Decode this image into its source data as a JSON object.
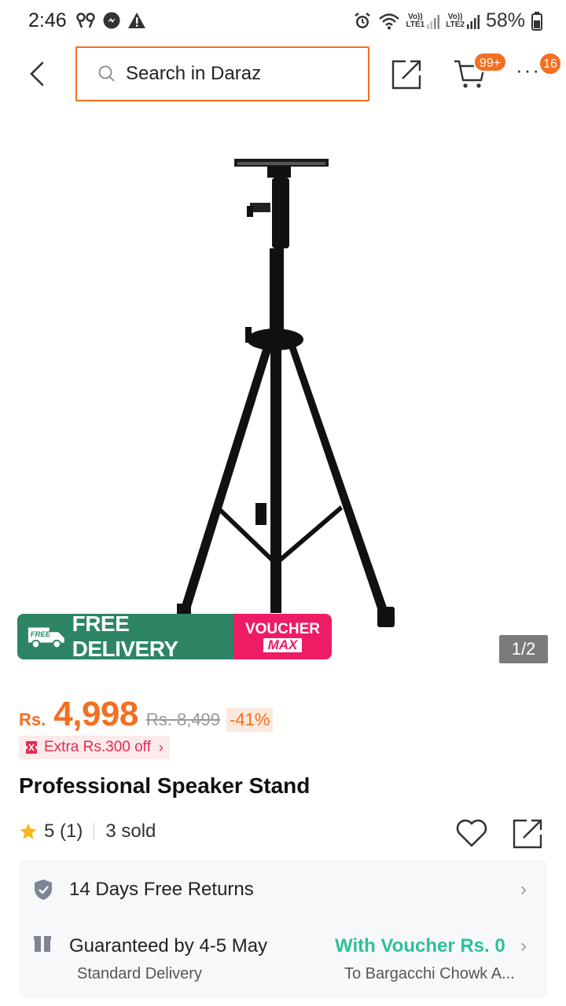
{
  "status_bar": {
    "time": "2:46",
    "battery": "58%",
    "sim1_label_top": "Vo))",
    "sim1_label_bottom": "LTE1",
    "sim2_label_top": "Vo))",
    "sim2_label_bottom": "LTE2"
  },
  "top_nav": {
    "search_placeholder": "Search in Daraz",
    "cart_badge": "99+",
    "more_badge": "16"
  },
  "product_image": {
    "promo_free_badge": "FREE",
    "promo_free_delivery": "FREE DELIVERY",
    "promo_voucher_line1": "VOUCHER",
    "promo_voucher_line2": "MAX",
    "page_indicator": "1/2"
  },
  "price": {
    "currency": "Rs.",
    "current": "4,998",
    "original": "Rs. 8,499",
    "discount": "-41%"
  },
  "extra_off": {
    "label": "Extra Rs.300 off"
  },
  "product": {
    "title": "Professional Speaker Stand",
    "rating": "5 (1)",
    "sold": "3 sold"
  },
  "info": {
    "returns": "14 Days Free Returns",
    "delivery_guarantee": "Guaranteed by 4-5 May",
    "delivery_type": "Standard Delivery",
    "voucher": "With Voucher Rs. 0",
    "location": "To Bargacchi Chowk A..."
  },
  "colors": {
    "brand": "#f36f21",
    "free_delivery_green": "#2d8564",
    "voucher_pink": "#ee1b65",
    "voucher_text_green": "#2fbf9b"
  }
}
